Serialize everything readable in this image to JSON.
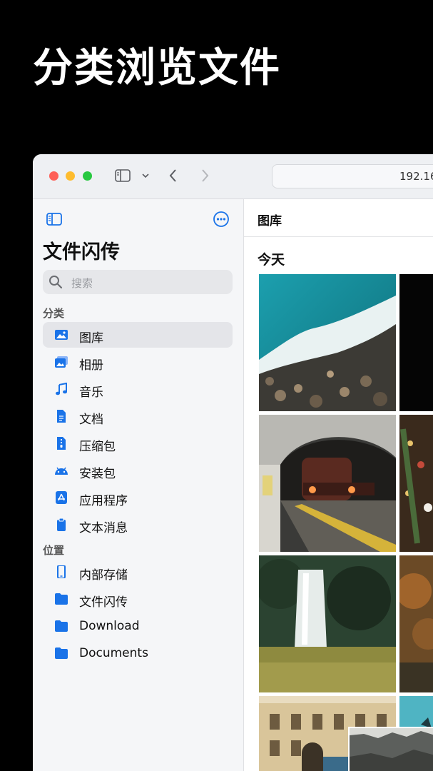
{
  "headline": "分类浏览文件",
  "browser": {
    "url": "192.16"
  },
  "sidebar": {
    "app_title": "文件闪传",
    "search_placeholder": "搜索",
    "sections": [
      {
        "title": "分类",
        "items": [
          {
            "label": "图库",
            "icon": "image-icon",
            "active": true
          },
          {
            "label": "相册",
            "icon": "photo-album-icon"
          },
          {
            "label": "音乐",
            "icon": "music-note-icon"
          },
          {
            "label": "文档",
            "icon": "document-icon"
          },
          {
            "label": "压缩包",
            "icon": "zip-icon"
          },
          {
            "label": "安装包",
            "icon": "android-icon"
          },
          {
            "label": "应用程序",
            "icon": "app-store-icon"
          },
          {
            "label": "文本消息",
            "icon": "clipboard-icon"
          }
        ]
      },
      {
        "title": "位置",
        "items": [
          {
            "label": "内部存储",
            "icon": "phone-icon"
          },
          {
            "label": "文件闪传",
            "icon": "folder-icon"
          },
          {
            "label": "Download",
            "icon": "folder-icon"
          },
          {
            "label": "Documents",
            "icon": "folder-icon"
          }
        ]
      }
    ]
  },
  "main": {
    "title": "图库",
    "date_header": "今天",
    "photos": [
      "ocean-waves-aerial",
      "dark-photo",
      "subway-train-tunnel",
      "christmas-decorations",
      "waterfall-meadow",
      "autumn-forest",
      "old-town-buildings",
      "teal-sky"
    ]
  },
  "colors": {
    "accent": "#1a73e8",
    "traffic_red": "#fe5f57",
    "traffic_yellow": "#febc2e",
    "traffic_green": "#28c840"
  }
}
